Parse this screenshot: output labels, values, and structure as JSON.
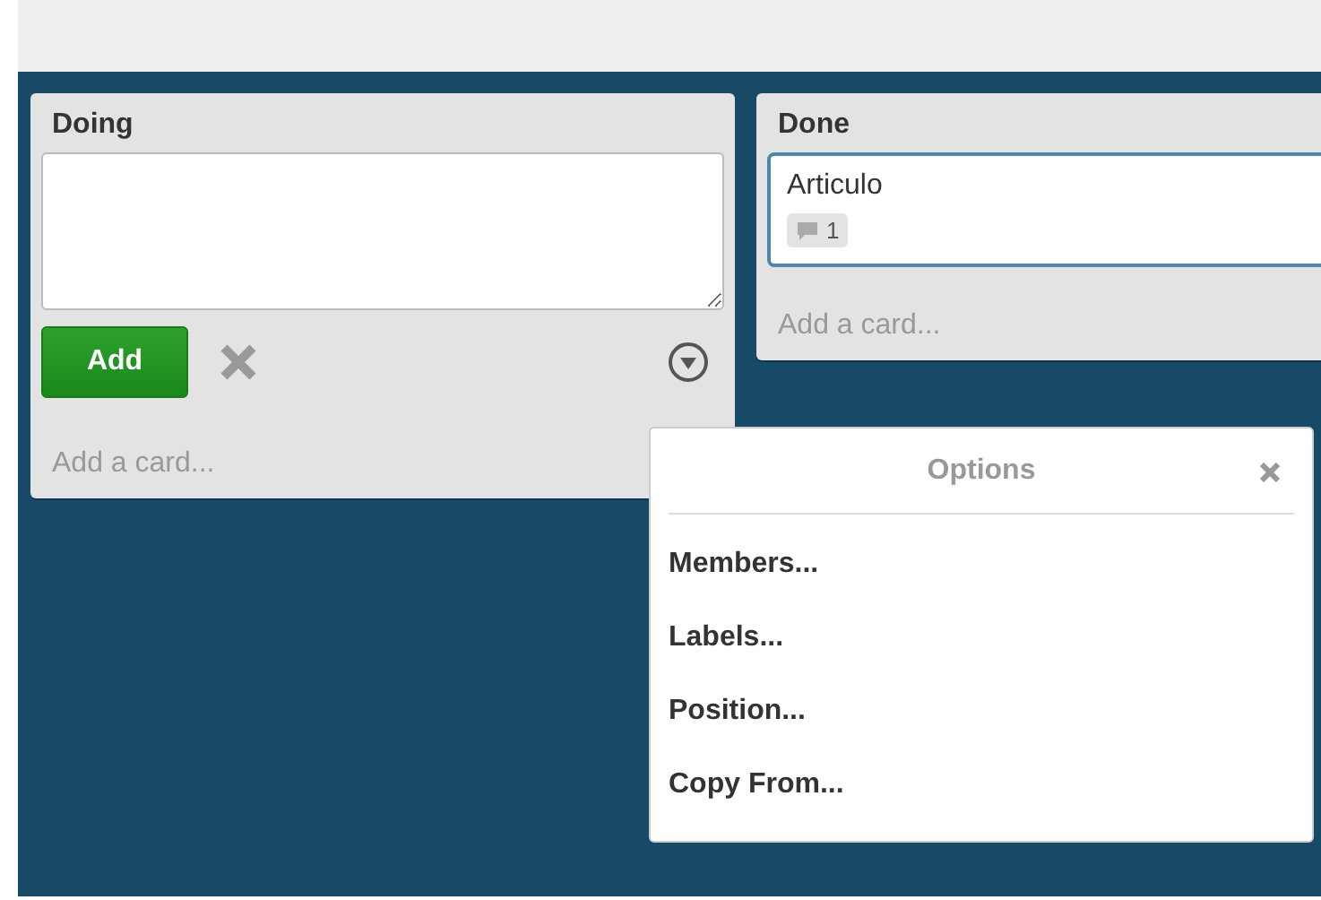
{
  "lists": [
    {
      "title": "Doing",
      "composer": {
        "add_button": "Add"
      },
      "add_card": "Add a card..."
    },
    {
      "title": "Done",
      "cards": [
        {
          "title": "Articulo",
          "comments": "1"
        }
      ],
      "add_card": "Add a card..."
    }
  ],
  "popover": {
    "title": "Options",
    "items": [
      "Members...",
      "Labels...",
      "Position...",
      "Copy From..."
    ]
  }
}
